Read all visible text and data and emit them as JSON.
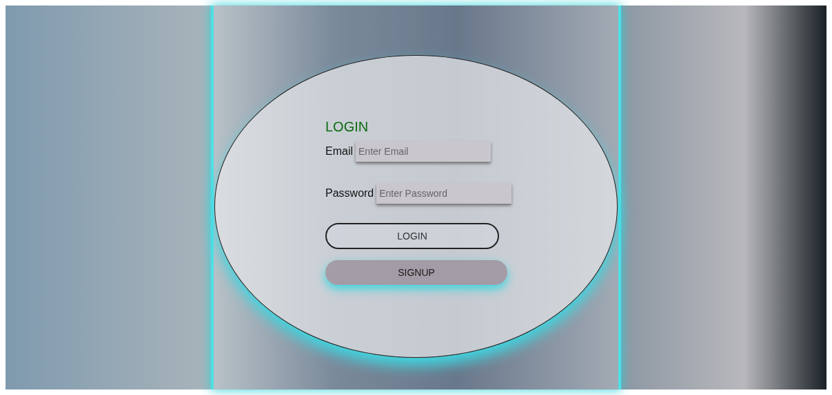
{
  "heading": "LOGIN",
  "fields": [
    {
      "label": "Email",
      "placeholder": "Enter Email"
    },
    {
      "label": "Password",
      "placeholder": "Enter Password"
    }
  ],
  "buttons": [
    {
      "label": "LOGIN",
      "kind": "outline"
    },
    {
      "label": "SIGNUP",
      "kind": "filled"
    }
  ]
}
